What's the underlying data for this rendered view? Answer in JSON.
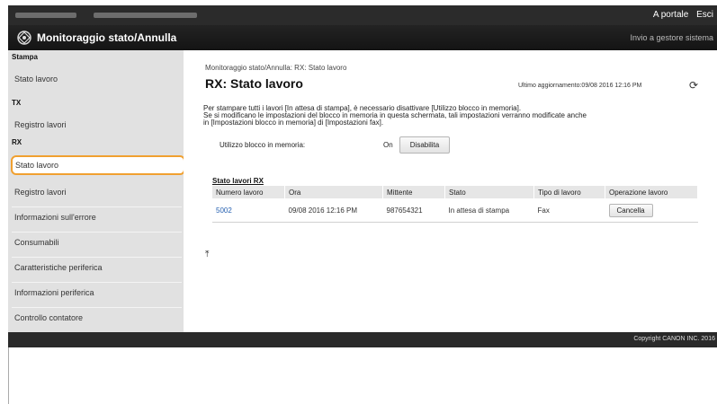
{
  "header": {
    "links": [
      "A portale",
      "Esci"
    ],
    "app_title": "Monitoraggio stato/Annulla",
    "settings_link": "Invio a gestore sistema"
  },
  "sidebar": {
    "groups": [
      {
        "heading": "Stampa",
        "items": [
          "Stato lavoro"
        ]
      },
      {
        "heading": "TX",
        "items": [
          "Registro lavori"
        ]
      },
      {
        "heading": "RX",
        "items": [
          "Stato lavoro",
          "Registro lavori",
          "Informazioni sull'errore",
          "Consumabili",
          "Caratteristiche periferica",
          "Informazioni periferica",
          "Controllo contatore"
        ]
      }
    ],
    "active_item": "Stato lavoro"
  },
  "main": {
    "breadcrumb": "Monitoraggio stato/Annulla: RX: Stato lavoro",
    "title": "RX: Stato lavoro",
    "last_update": "Ultimo aggiornamento:09/08 2016 12:16 PM",
    "notice_lines": [
      "Per stampare tutti i lavori [In attesa di stampa], è necessario disattivare [Utilizzo blocco in memoria].",
      "Se si modificano le impostazioni del blocco in memoria in questa schermata, tali impostazioni verranno modificate anche",
      "in [Impostazioni blocco in memoria] di [Impostazioni fax]."
    ],
    "setting_label": "Utilizzo blocco in memoria:",
    "setting_value": "On",
    "disable_button": "Disabilita",
    "table_caption": "Stato lavori RX",
    "table": {
      "columns": [
        "Numero lavoro",
        "Ora",
        "Mittente",
        "Stato",
        "Tipo di lavoro",
        "Operazione lavoro"
      ],
      "rows": [
        {
          "job_number": "5002",
          "time": "09/08 2016 12:16 PM",
          "sender": "987654321",
          "status": "In attesa di stampa",
          "job_type": "Fax",
          "action": "Cancella"
        }
      ]
    }
  },
  "footer": {
    "copyright": "Copyright CANON INC. 2016"
  }
}
